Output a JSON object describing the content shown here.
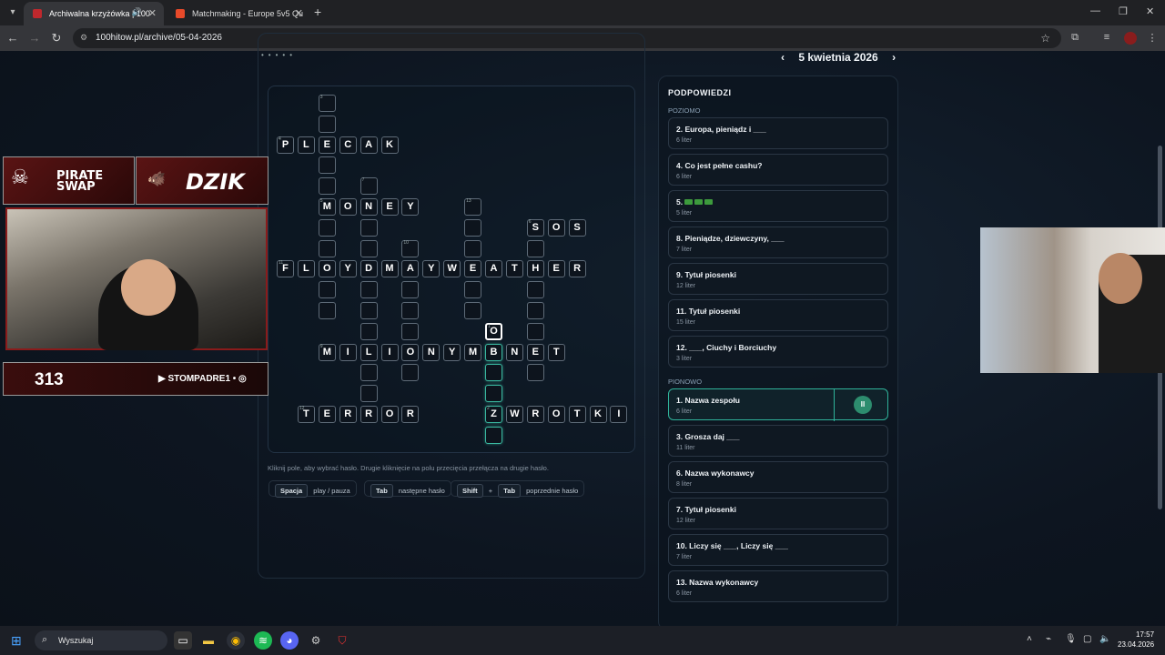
{
  "browser": {
    "tabs": [
      {
        "title": "Archiwalna krzyżówka | 100",
        "active": true
      },
      {
        "title": "Matchmaking - Europe 5v5 Qu",
        "active": false
      }
    ],
    "new_tab": "+",
    "url": "100hitow.pl/archive/05-04-2026"
  },
  "header": {
    "date": "5 kwietnia 2026",
    "prev_icon": "‹",
    "next_icon": "›"
  },
  "crossword": {
    "cells": [
      {
        "r": 0,
        "c": 2,
        "ch": "",
        "n": "3"
      },
      {
        "r": 1,
        "c": 2,
        "ch": "",
        "n": ""
      },
      {
        "r": 2,
        "c": 0,
        "ch": "P",
        "n": "4"
      },
      {
        "r": 2,
        "c": 1,
        "ch": "L",
        "n": ""
      },
      {
        "r": 2,
        "c": 2,
        "ch": "E",
        "n": ""
      },
      {
        "r": 2,
        "c": 3,
        "ch": "C",
        "n": ""
      },
      {
        "r": 2,
        "c": 4,
        "ch": "A",
        "n": ""
      },
      {
        "r": 2,
        "c": 5,
        "ch": "K",
        "n": ""
      },
      {
        "r": 3,
        "c": 2,
        "ch": "",
        "n": ""
      },
      {
        "r": 4,
        "c": 2,
        "ch": "",
        "n": ""
      },
      {
        "r": 4,
        "c": 4,
        "ch": "",
        "n": "7"
      },
      {
        "r": 5,
        "c": 2,
        "ch": "M",
        "n": "5"
      },
      {
        "r": 5,
        "c": 3,
        "ch": "O",
        "n": ""
      },
      {
        "r": 5,
        "c": 4,
        "ch": "N",
        "n": ""
      },
      {
        "r": 5,
        "c": 5,
        "ch": "E",
        "n": ""
      },
      {
        "r": 5,
        "c": 6,
        "ch": "Y",
        "n": ""
      },
      {
        "r": 5,
        "c": 9,
        "ch": "",
        "n": "13"
      },
      {
        "r": 6,
        "c": 2,
        "ch": "",
        "n": ""
      },
      {
        "r": 6,
        "c": 4,
        "ch": "",
        "n": ""
      },
      {
        "r": 6,
        "c": 9,
        "ch": "",
        "n": ""
      },
      {
        "r": 6,
        "c": 12,
        "ch": "S",
        "n": "6"
      },
      {
        "r": 6,
        "c": 13,
        "ch": "O",
        "n": ""
      },
      {
        "r": 6,
        "c": 14,
        "ch": "S",
        "n": ""
      },
      {
        "r": 7,
        "c": 2,
        "ch": "",
        "n": ""
      },
      {
        "r": 7,
        "c": 4,
        "ch": "",
        "n": ""
      },
      {
        "r": 7,
        "c": 6,
        "ch": "",
        "n": "10"
      },
      {
        "r": 7,
        "c": 9,
        "ch": "",
        "n": ""
      },
      {
        "r": 7,
        "c": 12,
        "ch": "",
        "n": ""
      },
      {
        "r": 8,
        "c": 0,
        "ch": "F",
        "n": "11"
      },
      {
        "r": 8,
        "c": 1,
        "ch": "L",
        "n": ""
      },
      {
        "r": 8,
        "c": 2,
        "ch": "O",
        "n": ""
      },
      {
        "r": 8,
        "c": 3,
        "ch": "Y",
        "n": ""
      },
      {
        "r": 8,
        "c": 4,
        "ch": "D",
        "n": ""
      },
      {
        "r": 8,
        "c": 5,
        "ch": "M",
        "n": ""
      },
      {
        "r": 8,
        "c": 6,
        "ch": "A",
        "n": ""
      },
      {
        "r": 8,
        "c": 7,
        "ch": "Y",
        "n": ""
      },
      {
        "r": 8,
        "c": 8,
        "ch": "W",
        "n": ""
      },
      {
        "r": 8,
        "c": 9,
        "ch": "E",
        "n": ""
      },
      {
        "r": 8,
        "c": 10,
        "ch": "A",
        "n": ""
      },
      {
        "r": 8,
        "c": 11,
        "ch": "T",
        "n": ""
      },
      {
        "r": 8,
        "c": 12,
        "ch": "H",
        "n": ""
      },
      {
        "r": 8,
        "c": 13,
        "ch": "E",
        "n": ""
      },
      {
        "r": 8,
        "c": 14,
        "ch": "R",
        "n": ""
      },
      {
        "r": 9,
        "c": 2,
        "ch": "",
        "n": ""
      },
      {
        "r": 9,
        "c": 4,
        "ch": "",
        "n": ""
      },
      {
        "r": 9,
        "c": 6,
        "ch": "",
        "n": ""
      },
      {
        "r": 9,
        "c": 9,
        "ch": "",
        "n": ""
      },
      {
        "r": 9,
        "c": 12,
        "ch": "",
        "n": ""
      },
      {
        "r": 10,
        "c": 2,
        "ch": "",
        "n": ""
      },
      {
        "r": 10,
        "c": 4,
        "ch": "",
        "n": ""
      },
      {
        "r": 10,
        "c": 6,
        "ch": "",
        "n": ""
      },
      {
        "r": 10,
        "c": 9,
        "ch": "",
        "n": ""
      },
      {
        "r": 10,
        "c": 12,
        "ch": "",
        "n": ""
      },
      {
        "r": 11,
        "c": 4,
        "ch": "",
        "n": ""
      },
      {
        "r": 11,
        "c": 6,
        "ch": "",
        "n": ""
      },
      {
        "r": 11,
        "c": 10,
        "ch": "O",
        "n": "1",
        "state": "cursor"
      },
      {
        "r": 11,
        "c": 12,
        "ch": "",
        "n": ""
      },
      {
        "r": 12,
        "c": 2,
        "ch": "M",
        "n": "9"
      },
      {
        "r": 12,
        "c": 3,
        "ch": "I",
        "n": ""
      },
      {
        "r": 12,
        "c": 4,
        "ch": "L",
        "n": ""
      },
      {
        "r": 12,
        "c": 5,
        "ch": "I",
        "n": ""
      },
      {
        "r": 12,
        "c": 6,
        "ch": "O",
        "n": ""
      },
      {
        "r": 12,
        "c": 7,
        "ch": "N",
        "n": ""
      },
      {
        "r": 12,
        "c": 8,
        "ch": "Y",
        "n": ""
      },
      {
        "r": 12,
        "c": 9,
        "ch": "M",
        "n": ""
      },
      {
        "r": 12,
        "c": 10,
        "ch": "B",
        "n": "",
        "state": "active"
      },
      {
        "r": 12,
        "c": 11,
        "ch": "N",
        "n": ""
      },
      {
        "r": 12,
        "c": 12,
        "ch": "E",
        "n": ""
      },
      {
        "r": 12,
        "c": 13,
        "ch": "T",
        "n": ""
      },
      {
        "r": 13,
        "c": 4,
        "ch": "",
        "n": ""
      },
      {
        "r": 13,
        "c": 6,
        "ch": "",
        "n": ""
      },
      {
        "r": 13,
        "c": 10,
        "ch": "",
        "n": "",
        "state": "active"
      },
      {
        "r": 13,
        "c": 12,
        "ch": "",
        "n": ""
      },
      {
        "r": 14,
        "c": 4,
        "ch": "",
        "n": ""
      },
      {
        "r": 14,
        "c": 10,
        "ch": "",
        "n": "",
        "state": "active"
      },
      {
        "r": 15,
        "c": 1,
        "ch": "T",
        "n": "12"
      },
      {
        "r": 15,
        "c": 2,
        "ch": "E",
        "n": ""
      },
      {
        "r": 15,
        "c": 3,
        "ch": "R",
        "n": ""
      },
      {
        "r": 15,
        "c": 4,
        "ch": "R",
        "n": ""
      },
      {
        "r": 15,
        "c": 5,
        "ch": "O",
        "n": ""
      },
      {
        "r": 15,
        "c": 6,
        "ch": "R",
        "n": ""
      },
      {
        "r": 15,
        "c": 10,
        "ch": "Z",
        "n": "2",
        "state": "active"
      },
      {
        "r": 15,
        "c": 11,
        "ch": "W",
        "n": ""
      },
      {
        "r": 15,
        "c": 12,
        "ch": "R",
        "n": ""
      },
      {
        "r": 15,
        "c": 13,
        "ch": "O",
        "n": ""
      },
      {
        "r": 15,
        "c": 14,
        "ch": "T",
        "n": ""
      },
      {
        "r": 15,
        "c": 15,
        "ch": "K",
        "n": ""
      },
      {
        "r": 15,
        "c": 16,
        "ch": "I",
        "n": ""
      },
      {
        "r": 16,
        "c": 10,
        "ch": "",
        "n": "",
        "state": "active"
      }
    ],
    "hint": "Kliknij pole, aby wybrać hasło. Drugie kliknięcie na polu przecięcia przełącza na drugie hasło.",
    "shortcuts": {
      "space_key": "Spacja",
      "space_desc": "play / pauza",
      "tab_key": "Tab",
      "tab_desc": "następne hasło",
      "shift_key": "Shift",
      "plus": "+",
      "shift_tab_key": "Tab",
      "shift_desc": "poprzednie hasło"
    }
  },
  "clues": {
    "title": "PODPOWIEDZI",
    "across_label": "POZIOMO",
    "down_label": "PIONOWO",
    "across": [
      {
        "text": "2. Europa, pieniądz i ___",
        "len": "6 liter"
      },
      {
        "text": "4. Co jest pełne cashu?",
        "len": "6 liter"
      },
      {
        "text": "5.",
        "len": "5 liter",
        "emoji": true
      },
      {
        "text": "8. Pieniądze, dziewczyny, ___",
        "len": "7 liter"
      },
      {
        "text": "9. Tytuł piosenki",
        "len": "12 liter"
      },
      {
        "text": "11. Tytuł piosenki",
        "len": "15 liter"
      },
      {
        "text": "12. ___, Ciuchy i Borciuchy",
        "len": "3 liter"
      }
    ],
    "down": [
      {
        "text": "1. Nazwa zespołu",
        "len": "6 liter",
        "active": true
      },
      {
        "text": "3. Grosza daj ___",
        "len": "11 liter"
      },
      {
        "text": "6. Nazwa wykonawcy",
        "len": "8 liter"
      },
      {
        "text": "7. Tytuł piosenki",
        "len": "12 liter"
      },
      {
        "text": "10. Liczy się ___, Liczy się ___",
        "len": "7 liter"
      },
      {
        "text": "13. Nazwa wykonawcy",
        "len": "6 liter"
      }
    ],
    "pause_icon": "II"
  },
  "overlay": {
    "sponsor1": "PIRATE SWAP",
    "sponsor2": "DZIK",
    "counter": "313",
    "channel": "STOMPADRE1"
  },
  "taskbar": {
    "search_placeholder": "Wyszukaj",
    "time": "17:57",
    "date": "23.04.2026"
  }
}
